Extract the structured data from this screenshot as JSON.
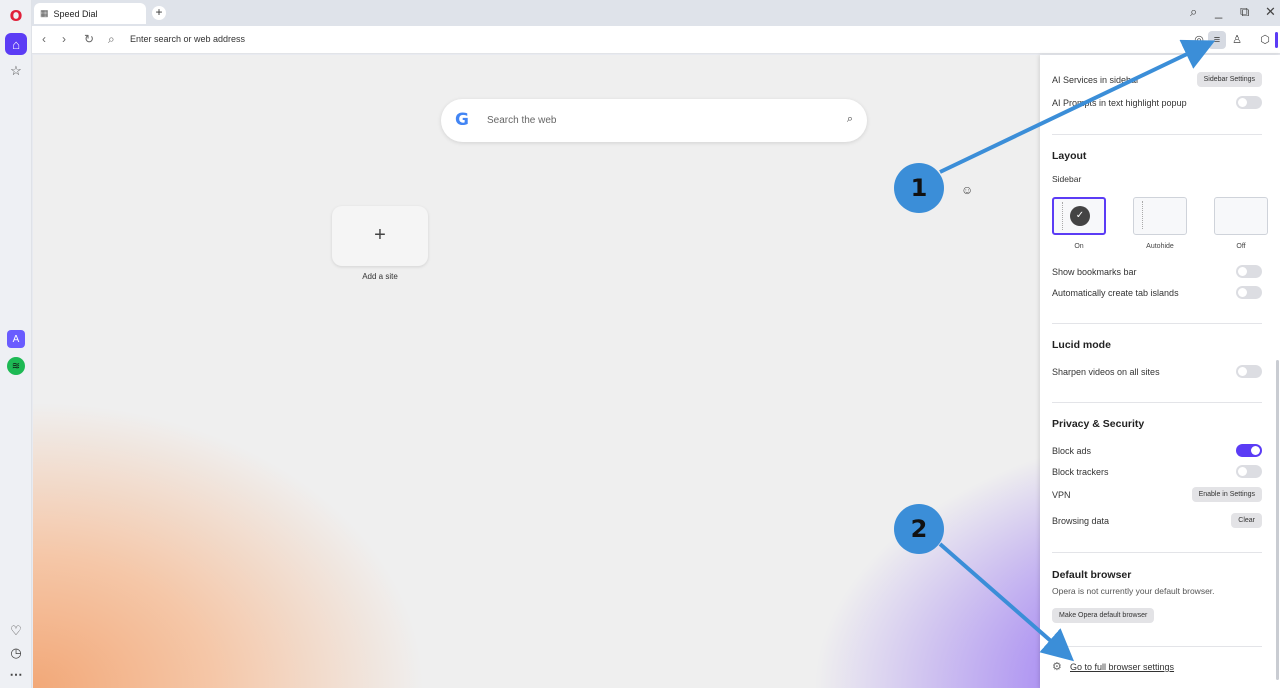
{
  "tab": {
    "title": "Speed Dial",
    "icon": "grid-icon"
  },
  "window_controls": {
    "search": "⌕",
    "minimize": "_",
    "restore": "⧉",
    "close": "✕"
  },
  "address": {
    "placeholder": "Enter search or web address"
  },
  "search": {
    "placeholder": "Search the web",
    "engine_logo": "G"
  },
  "speed_dial": {
    "add_label": "Add a site",
    "add_symbol": "+"
  },
  "panel": {
    "ai_services_label": "AI Services in sidebar",
    "sidebar_settings_btn": "Sidebar Settings",
    "ai_prompts_label": "AI Prompts in text highlight popup",
    "layout_title": "Layout",
    "sidebar_label": "Sidebar",
    "layout_options": [
      "On",
      "Autohide",
      "Off"
    ],
    "show_bookmarks_label": "Show bookmarks bar",
    "tab_islands_label": "Automatically create tab islands",
    "lucid_title": "Lucid mode",
    "sharpen_label": "Sharpen videos on all sites",
    "privacy_title": "Privacy & Security",
    "block_ads_label": "Block ads",
    "block_trackers_label": "Block trackers",
    "vpn_label": "VPN",
    "vpn_btn": "Enable in Settings",
    "browsing_data_label": "Browsing data",
    "clear_btn": "Clear",
    "default_title": "Default browser",
    "default_desc": "Opera is not currently your default browser.",
    "make_default_btn": "Make Opera default browser",
    "full_settings_link": "Go to full browser settings"
  },
  "annotations": {
    "one": "1",
    "two": "2"
  },
  "colors": {
    "accent": "#5b3cf5",
    "annotation": "#3b8ed8"
  }
}
